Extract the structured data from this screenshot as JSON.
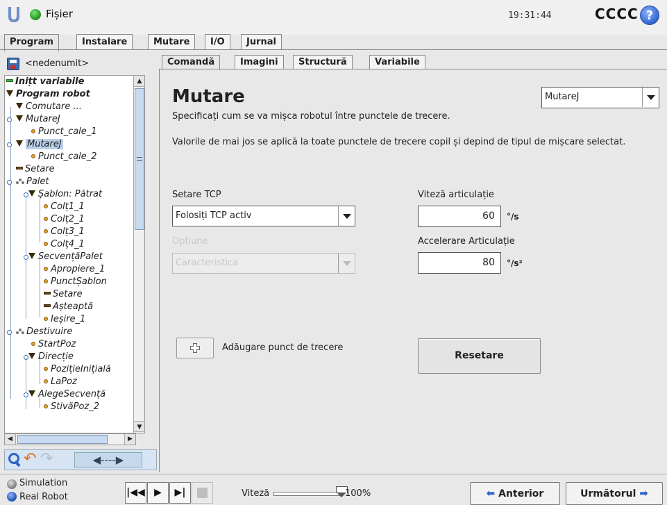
{
  "topbar": {
    "file_menu": "Fișier",
    "clock": "19:31:44",
    "robot_name": "CCCC",
    "help_label": "?"
  },
  "main_tabs": [
    {
      "label": "Program",
      "active": true
    },
    {
      "label": "Instalare",
      "active": false
    },
    {
      "label": "Mutare",
      "active": false
    },
    {
      "label": "I/O",
      "active": false
    },
    {
      "label": "Jurnal",
      "active": false
    }
  ],
  "program": {
    "name": "<nedenumit>"
  },
  "tree": [
    {
      "label": "Inițt variabile",
      "icon": "bar-green"
    },
    {
      "label": "Program robot",
      "icon": "triangle"
    },
    {
      "label": "Comutare ...",
      "icon": "triangle"
    },
    {
      "label": "MutareJ",
      "icon": "triangle"
    },
    {
      "label": "Punct_cale_1",
      "icon": "waypoint"
    },
    {
      "label": "MutareJ",
      "icon": "triangle",
      "selected": true
    },
    {
      "label": "Punct_cale_2",
      "icon": "waypoint"
    },
    {
      "label": "Setare",
      "icon": "bar"
    },
    {
      "label": "Palet",
      "icon": "pallet"
    },
    {
      "label": "Șablon: Pătrat",
      "icon": "triangle"
    },
    {
      "label": "Colț1_1",
      "icon": "waypoint"
    },
    {
      "label": "Colț2_1",
      "icon": "waypoint"
    },
    {
      "label": "Colț3_1",
      "icon": "waypoint"
    },
    {
      "label": "Colț4_1",
      "icon": "waypoint"
    },
    {
      "label": "SecvențăPalet",
      "icon": "triangle"
    },
    {
      "label": "Apropiere_1",
      "icon": "waypoint"
    },
    {
      "label": "PunctȘablon",
      "icon": "waypoint"
    },
    {
      "label": "Setare",
      "icon": "bar"
    },
    {
      "label": "Așteaptă",
      "icon": "bar"
    },
    {
      "label": "Ieșire_1",
      "icon": "waypoint"
    },
    {
      "label": "Destivuire",
      "icon": "pallet"
    },
    {
      "label": "StartPoz",
      "icon": "waypoint"
    },
    {
      "label": "Direcție",
      "icon": "triangle"
    },
    {
      "label": "PozițieInițială",
      "icon": "waypoint"
    },
    {
      "label": "LaPoz",
      "icon": "waypoint"
    },
    {
      "label": "AlegeSecvență",
      "icon": "triangle"
    },
    {
      "label": "StivăPoz_2",
      "icon": "waypoint"
    }
  ],
  "tree_tools": {
    "move_glyph": "◀----▶",
    "undo_glyph": "↶",
    "redo_glyph": "↷"
  },
  "sub_tabs": [
    {
      "label": "Comandă",
      "active": true
    },
    {
      "label": "Imagini",
      "active": false
    },
    {
      "label": "Structură",
      "active": false
    },
    {
      "label": "Variabile",
      "active": false
    }
  ],
  "command": {
    "title": "Mutare",
    "description": "Specificați cum se va mișca robotul între punctele de trecere.",
    "note": "Valorile de mai jos se aplică la toate punctele de trecere copil și depind de tipul de mișcare selectat.",
    "motion_type": "MutareJ",
    "tcp_label": "Setare TCP",
    "tcp_value": "Folosiți TCP activ",
    "option_label": "Opțiune",
    "option_value": "Caracteristica",
    "joint_speed_label": "Viteză articulație",
    "joint_speed_value": "60",
    "joint_speed_unit": "°/s",
    "joint_accel_label": "Accelerare Articulație",
    "joint_accel_value": "80",
    "joint_accel_unit": "°/s²",
    "add_waypoint_label": "Adăugare punct de trecere",
    "reset_label": "Resetare"
  },
  "bottombar": {
    "simulation_label": "Simulation",
    "real_robot_label": "Real Robot",
    "speed_label": "Viteză",
    "speed_value": "100%",
    "speed_fraction": 1.0,
    "prev_label": "Anterior",
    "next_label": "Următorul"
  },
  "colors": {
    "accent_blue": "#2c63c8",
    "selection": "#b9cfe8",
    "tool_bg": "#d6e4f4"
  }
}
